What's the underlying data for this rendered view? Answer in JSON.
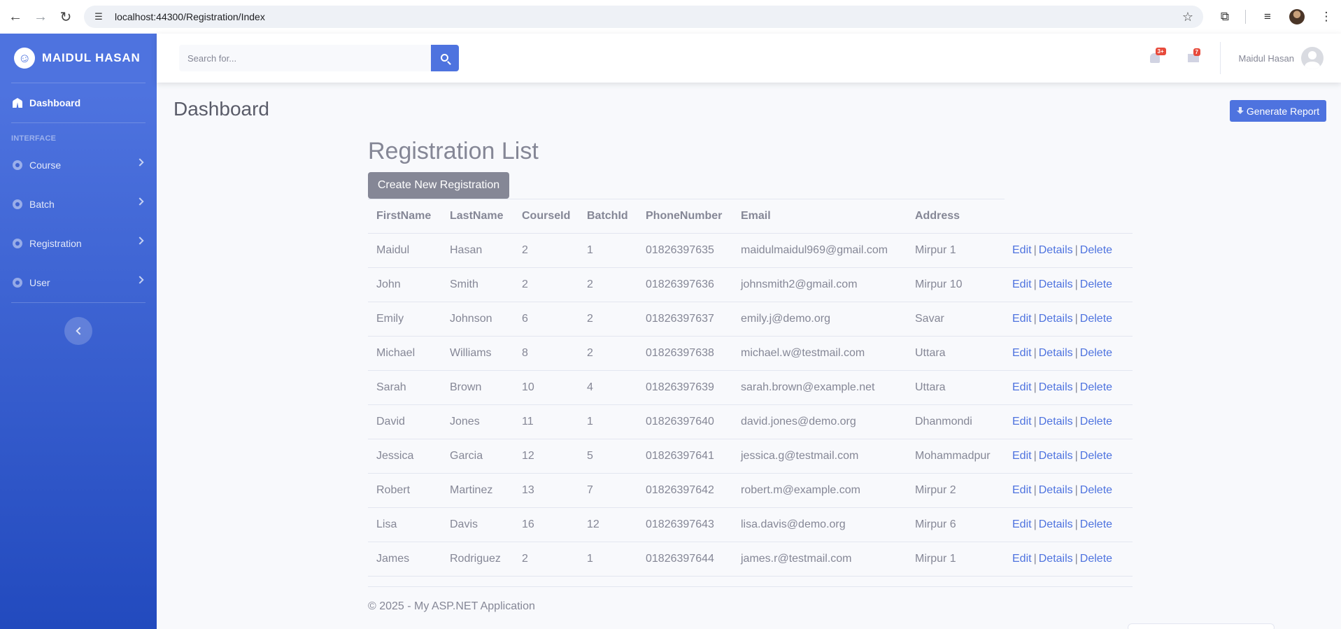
{
  "browser": {
    "url_host": "localhost",
    "url_rest": ":44300/Registration/Index"
  },
  "brand": {
    "name": "MAIDUL HASAN",
    "logo_glyph": "☺"
  },
  "sidebar": {
    "dashboard_label": "Dashboard",
    "heading": "INTERFACE",
    "items": [
      {
        "label": "Course",
        "icon": "gear-icon"
      },
      {
        "label": "Batch",
        "icon": "gear-icon"
      },
      {
        "label": "Registration",
        "icon": "gear-icon"
      },
      {
        "label": "User",
        "icon": "gear-icon"
      }
    ]
  },
  "topbar": {
    "search_placeholder": "Search for...",
    "alerts_badge": "3+",
    "messages_badge": "7",
    "user_name": "Maidul Hasan"
  },
  "page": {
    "title": "Dashboard",
    "report_button": "Generate Report"
  },
  "registration": {
    "title": "Registration List",
    "create_button": "Create New Registration",
    "columns": [
      "FirstName",
      "LastName",
      "CourseId",
      "BatchId",
      "PhoneNumber",
      "Email",
      "Address"
    ],
    "action_labels": {
      "edit": "Edit",
      "details": "Details",
      "delete": "Delete",
      "separator": "|"
    },
    "rows": [
      [
        "Maidul",
        "Hasan",
        "2",
        "1",
        "01826397635",
        "maidulmaidul969@gmail.com",
        "Mirpur 1"
      ],
      [
        "John",
        "Smith",
        "2",
        "2",
        "01826397636",
        "johnsmith2@gmail.com",
        "Mirpur 10"
      ],
      [
        "Emily",
        "Johnson",
        "6",
        "2",
        "01826397637",
        "emily.j@demo.org",
        "Savar"
      ],
      [
        "Michael",
        "Williams",
        "8",
        "2",
        "01826397638",
        "michael.w@testmail.com",
        "Uttara"
      ],
      [
        "Sarah",
        "Brown",
        "10",
        "4",
        "01826397639",
        "sarah.brown@example.net",
        "Uttara"
      ],
      [
        "David",
        "Jones",
        "11",
        "1",
        "01826397640",
        "david.jones@demo.org",
        "Dhanmondi"
      ],
      [
        "Jessica",
        "Garcia",
        "12",
        "5",
        "01826397641",
        "jessica.g@testmail.com",
        "Mohammadpur"
      ],
      [
        "Robert",
        "Martinez",
        "13",
        "7",
        "01826397642",
        "robert.m@example.com",
        "Mirpur 2"
      ],
      [
        "Lisa",
        "Davis",
        "16",
        "12",
        "01826397643",
        "lisa.davis@demo.org",
        "Mirpur 6"
      ],
      [
        "James",
        "Rodriguez",
        "2",
        "1",
        "01826397644",
        "james.r@testmail.com",
        "Mirpur 1"
      ]
    ]
  },
  "footer": {
    "text": "© 2025 - My ASP.NET Application"
  },
  "colors": {
    "primary": "#4e73df",
    "secondary": "#858796",
    "danger": "#e74a3b"
  }
}
